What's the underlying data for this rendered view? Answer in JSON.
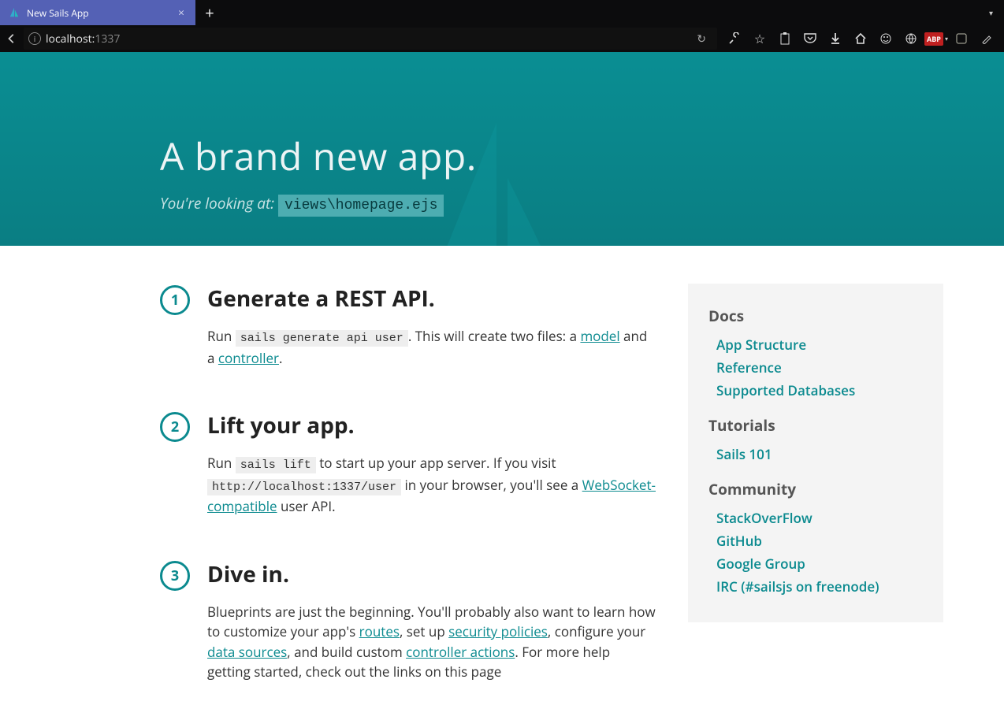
{
  "browser": {
    "tab_title": "New Sails App",
    "url_host": "localhost:",
    "url_port": "1337"
  },
  "hero": {
    "title": "A brand new app.",
    "subtitle_prefix": "You're looking at: ",
    "subtitle_code": "views\\homepage.ejs"
  },
  "steps": [
    {
      "num": "1",
      "title": "Generate a REST API.",
      "p1_a": "Run ",
      "code": "sails generate api user",
      "p1_b": ". This will create two files: a ",
      "link1": "model",
      "p1_c": " and a ",
      "link2": "controller",
      "p1_d": "."
    },
    {
      "num": "2",
      "title": "Lift your app.",
      "p1_a": "Run ",
      "code": "sails lift",
      "p1_b": " to start up your app server. If you visit ",
      "code2": "http://localhost:1337/user",
      "p1_c": " in your browser, you'll see a ",
      "link1": "WebSocket-compatible",
      "p1_d": " user API."
    },
    {
      "num": "3",
      "title": "Dive in.",
      "p1_a": "Blueprints are just the beginning. You'll probably also want to learn how to customize your app's ",
      "link1": "routes",
      "p1_b": ", set up ",
      "link2": "security policies",
      "p1_c": ", configure your ",
      "link3": "data sources",
      "p1_d": ", and build custom ",
      "link4": "controller actions",
      "p1_e": ". For more help getting started, check out the links on this page"
    }
  ],
  "sidebar": {
    "docs_heading": "Docs",
    "docs_links": [
      "App Structure",
      "Reference",
      "Supported Databases"
    ],
    "tutorials_heading": "Tutorials",
    "tutorials_links": [
      "Sails 101"
    ],
    "community_heading": "Community",
    "community_links": [
      "StackOverFlow",
      "GitHub",
      "Google Group",
      "IRC (#sailsjs on freenode)"
    ]
  }
}
